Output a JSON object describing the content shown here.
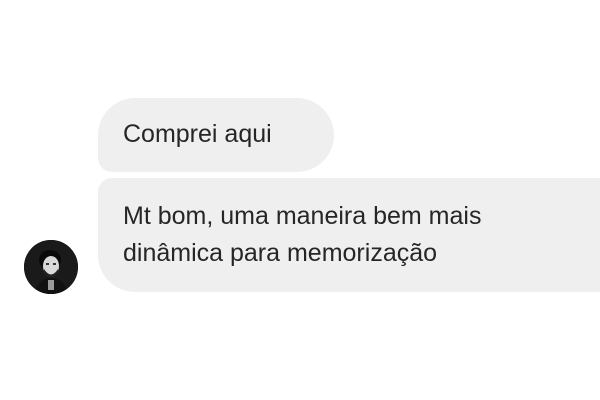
{
  "conversation": {
    "messages": [
      {
        "lines": [
          "Comprei aqui"
        ]
      },
      {
        "lines": [
          "Mt bom, uma maneira bem mais",
          "dinâmica para memorização"
        ]
      }
    ],
    "sender_avatar_icon": "user-avatar-photo"
  },
  "colors": {
    "background": "#ffffff",
    "bubble": "#efefef",
    "text": "#262626",
    "avatar_bg": "#1a1a1a"
  }
}
